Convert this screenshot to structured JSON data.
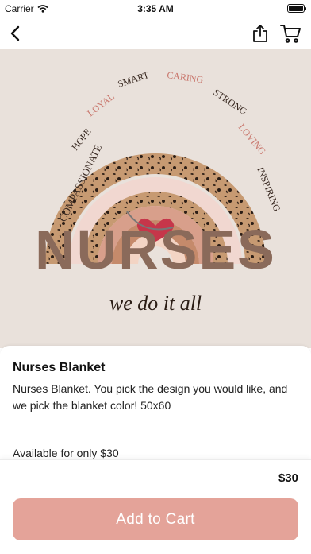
{
  "status_bar": {
    "carrier": "Carrier",
    "time": "3:35 AM"
  },
  "nav": {
    "back_icon": "chevron-left-icon",
    "share_icon": "share-icon",
    "cart_icon": "cart-icon"
  },
  "hero": {
    "words": [
      "COMPASSIONATE",
      "HOPE",
      "LOYAL",
      "SMART",
      "CARING",
      "STRONG",
      "LOVING",
      "INSPIRING"
    ],
    "title": "NURSES",
    "tagline": "we do it all"
  },
  "product": {
    "title": "Nurses Blanket",
    "description": "Nurses Blanket. You pick the design you would like, and we pick the blanket color! 50x60",
    "availability": "Available for only $30",
    "price": "$30",
    "add_to_cart_label": "Add to Cart"
  },
  "colors": {
    "accent": "#e4a399",
    "background": "#ffffff"
  }
}
